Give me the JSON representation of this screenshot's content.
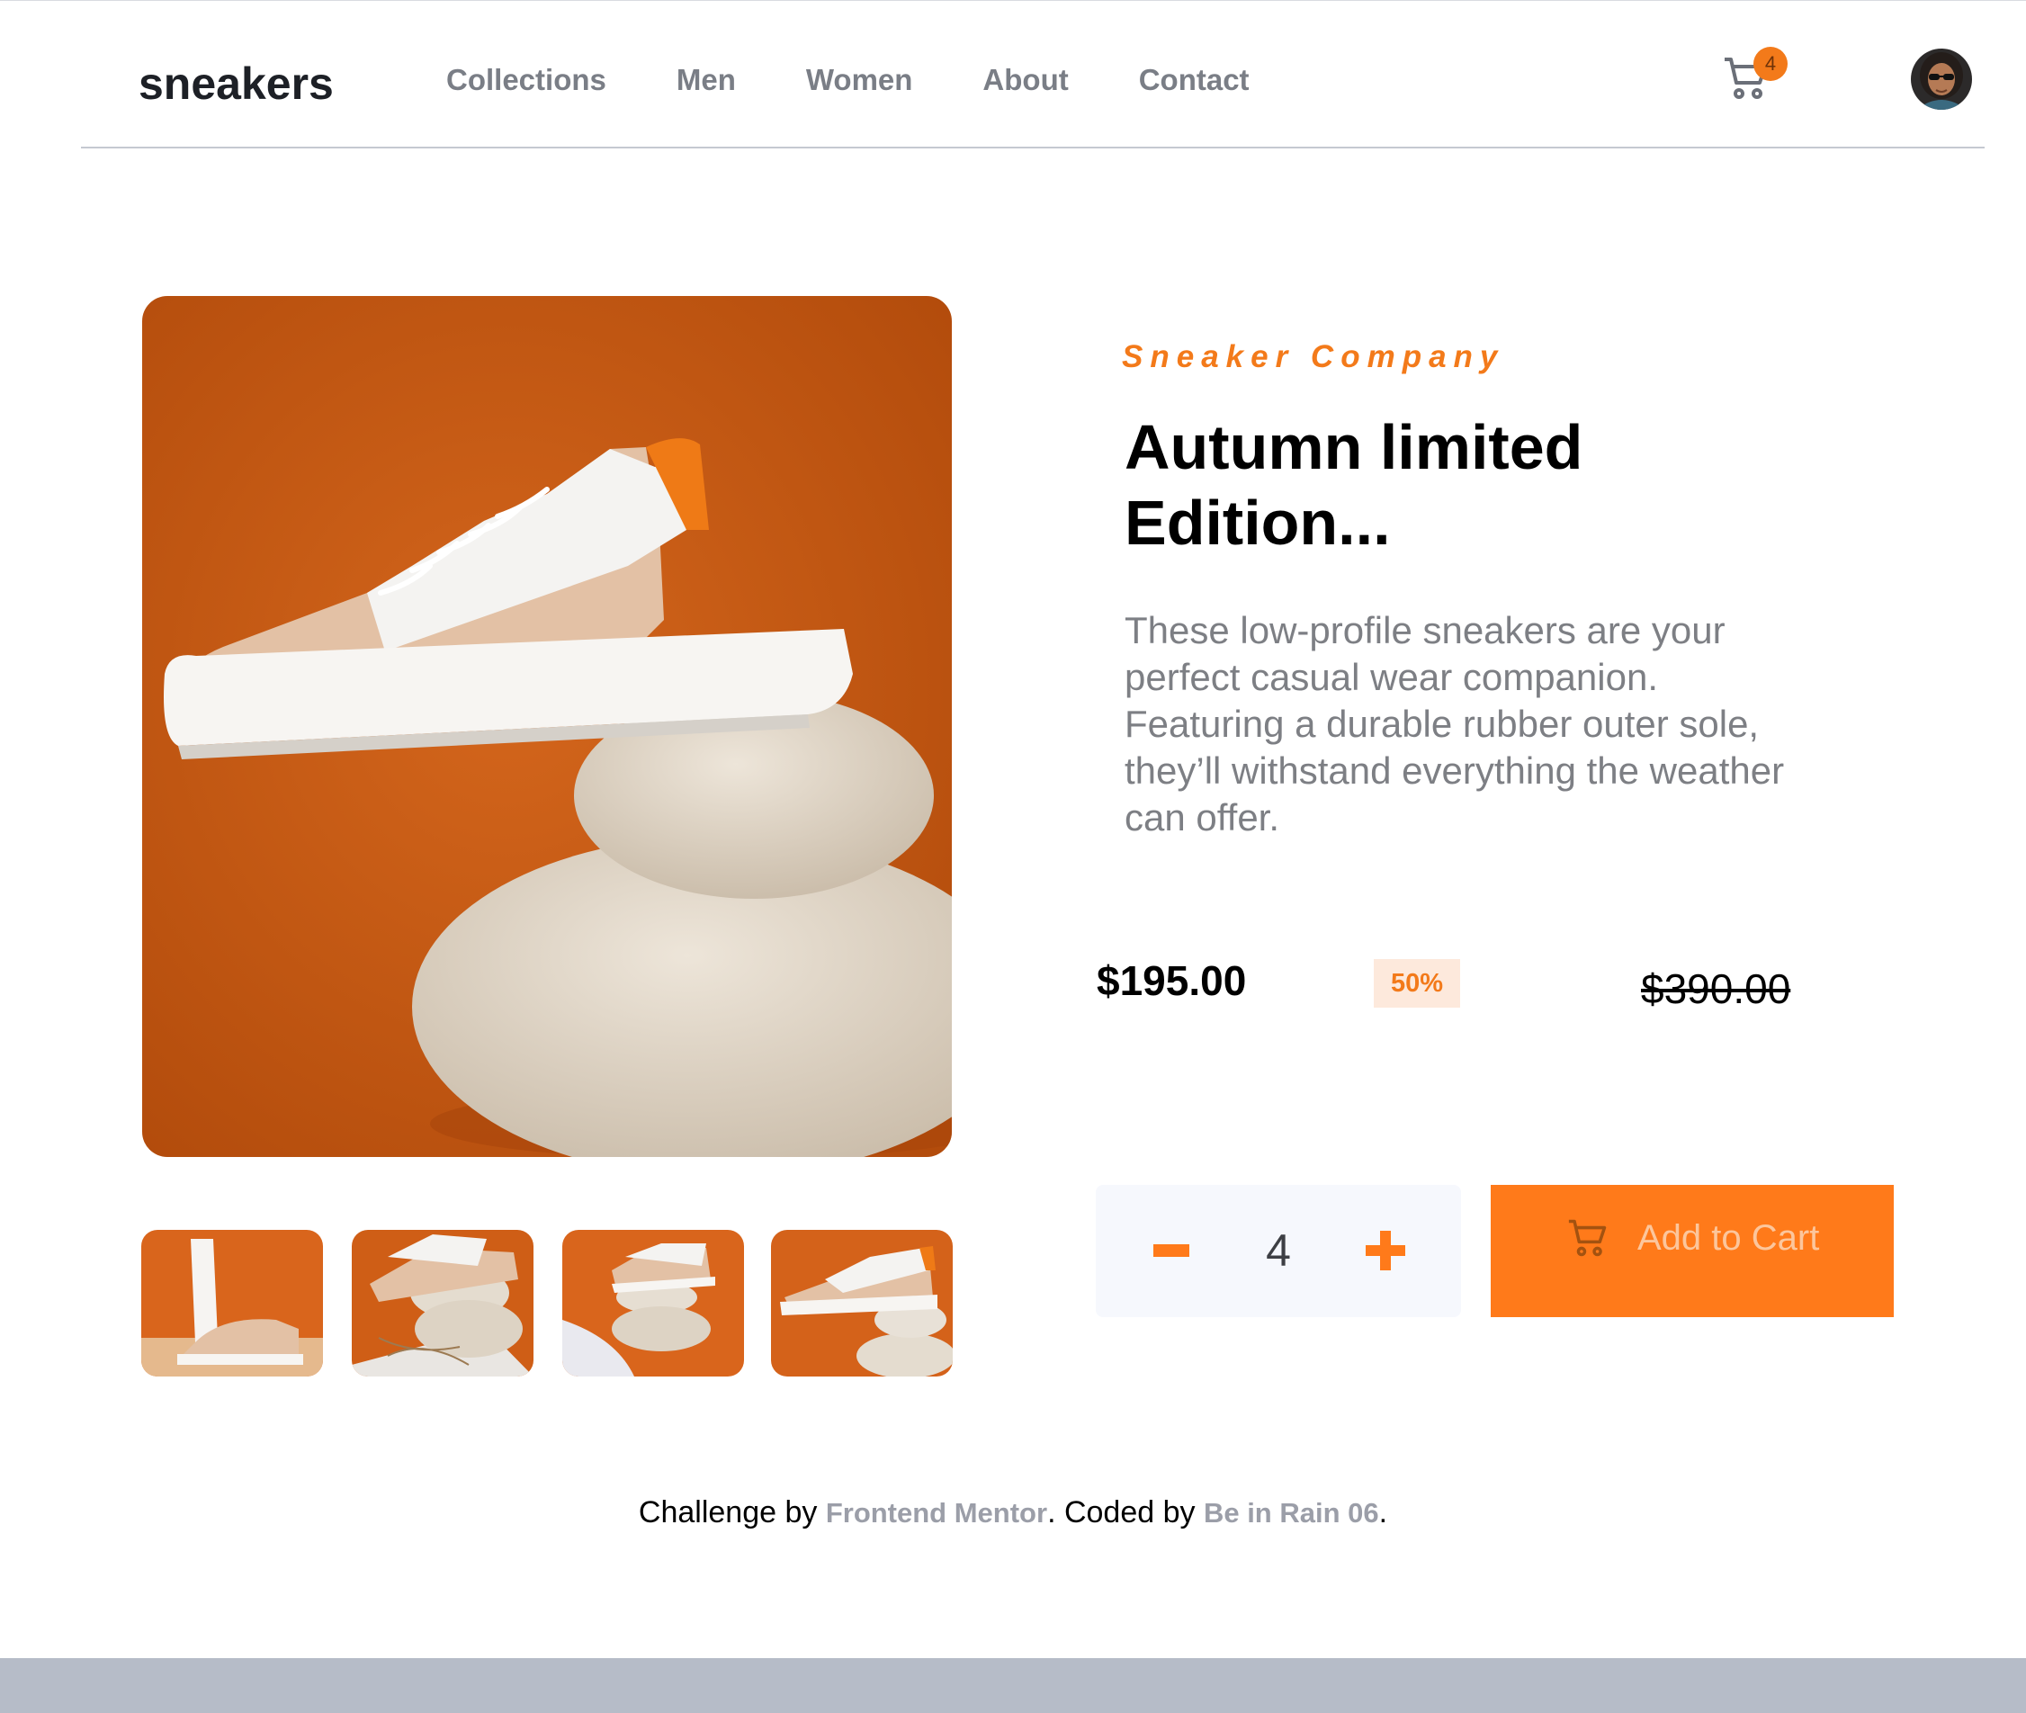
{
  "header": {
    "logo_text": "sneakers",
    "nav": [
      "Collections",
      "Men",
      "Women",
      "About",
      "Contact"
    ],
    "cart_count": "4"
  },
  "product": {
    "company": "Sneaker Company",
    "title": "Autumn limited Edition...",
    "description": "These low-profile sneakers are your perfect casual wear companion. Featuring a durable rubber outer sole, they’ll withstand everything the weather can offer.",
    "price": "$195.00",
    "discount": "50%",
    "original_price": "$390.00",
    "quantity": "4",
    "add_to_cart_label": "Add to Cart"
  },
  "gallery": {
    "thumbnail_count": 4
  },
  "footer": {
    "prefix": "Challenge by ",
    "link1": "Frontend Mentor",
    "middle": ". Coded by ",
    "link2": "Be in Rain 06",
    "suffix": "."
  },
  "colors": {
    "accent": "#ff7a1a",
    "pale_accent": "#fde9dc",
    "text_dark": "#000000",
    "text_muted": "#7d7f84"
  }
}
